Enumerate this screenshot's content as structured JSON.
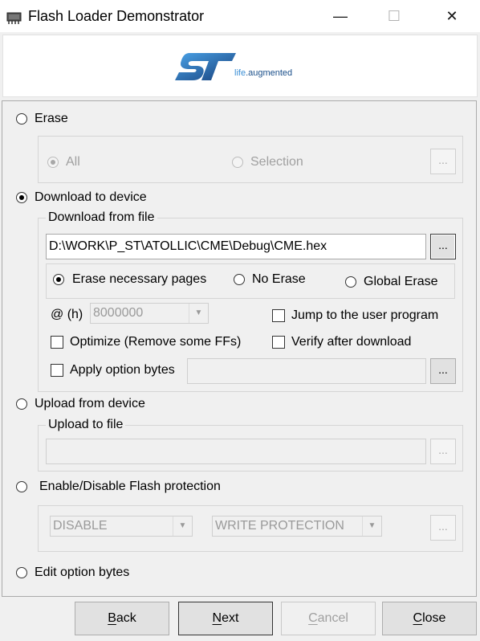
{
  "window": {
    "title": "Flash Loader Demonstrator",
    "minimize_glyph": "—",
    "maximize_glyph": "☐",
    "close_glyph": "✕"
  },
  "banner": {
    "logo_icon": "st-logo-icon",
    "tagline_prefix": "life",
    "tagline_suffix": ".augmented"
  },
  "erase": {
    "label": "Erase",
    "selected": false,
    "all_label": "All",
    "selection_label": "Selection",
    "browse_label": "..."
  },
  "download": {
    "label": "Download to device",
    "selected": true,
    "group_label": "Download from file",
    "file_path": "D:\\WORK\\P_ST\\ATOLLIC\\CME\\Debug\\CME.hex",
    "browse_label": "...",
    "erase_options": [
      "Erase necessary pages",
      "No Erase",
      "Global Erase"
    ],
    "erase_selected": "Erase necessary pages",
    "address_prefix": "@  (h)",
    "address_value": "8000000",
    "jump_label": "Jump to the user program",
    "optimize_label": "Optimize (Remove some FFs)",
    "verify_label": "Verify after download",
    "apply_option_label": "Apply option bytes",
    "option_browse_label": "..."
  },
  "upload": {
    "label": "Upload from device",
    "group_label": "Upload to file",
    "browse_label": "..."
  },
  "protection": {
    "label": "Enable/Disable Flash protection",
    "mode_value": "DISABLE",
    "type_value": "WRITE PROTECTION",
    "browse_label": "..."
  },
  "edit_option": {
    "label": "Edit option bytes"
  },
  "buttons": {
    "back": "Back",
    "next": "Next",
    "cancel": "Cancel",
    "close": "Close"
  },
  "colors": {
    "st_blue": "#1a5fa8",
    "st_light_blue": "#3b8fd6"
  }
}
